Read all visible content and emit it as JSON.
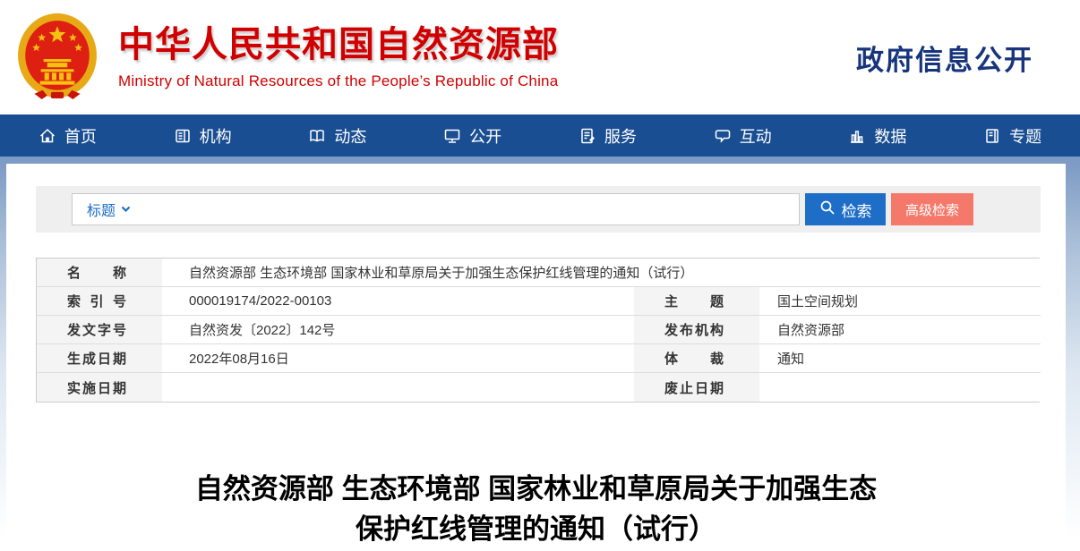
{
  "header": {
    "site_title": "中华人民共和国自然资源部",
    "site_subtitle": "Ministry of Natural Resources of the People’s Republic of China",
    "section_title": "政府信息公开"
  },
  "nav": {
    "items": [
      {
        "label": "首页",
        "icon": "home-icon"
      },
      {
        "label": "机构",
        "icon": "organization-icon"
      },
      {
        "label": "动态",
        "icon": "news-book-icon"
      },
      {
        "label": "公开",
        "icon": "monitor-icon"
      },
      {
        "label": "服务",
        "icon": "document-pencil-icon"
      },
      {
        "label": "互动",
        "icon": "chat-bubble-icon"
      },
      {
        "label": "数据",
        "icon": "bar-chart-icon"
      },
      {
        "label": "专题",
        "icon": "journal-icon"
      }
    ]
  },
  "search": {
    "field_selector": "标题",
    "input_value": "",
    "search_button": "检索",
    "advanced_button": "高级检索"
  },
  "doc_meta": {
    "name_label": "名称",
    "name_value": "自然资源部 生态环境部 国家林业和草原局关于加强生态保护红线管理的通知（试行）",
    "rows": [
      {
        "label1": "索引号",
        "value1": "000019174/2022-00103",
        "label2": "主题",
        "value2": "国土空间规划"
      },
      {
        "label1": "发文字号",
        "value1": "自然资发〔2022〕142号",
        "label2": "发布机构",
        "value2": "自然资源部"
      },
      {
        "label1": "生成日期",
        "value1": "2022年08月16日",
        "label2": "体裁",
        "value2": "通知"
      },
      {
        "label1": "实施日期",
        "value1": "",
        "label2": "废止日期",
        "value2": ""
      }
    ]
  },
  "article": {
    "title": "自然资源部 生态环境部 国家林业和草原局关于加强生态保护红线管理的通知（试行）"
  },
  "colors": {
    "nav_blue": "#1a4e92",
    "strip_blue": "#7d9bc4",
    "brand_red": "#d10000",
    "header_navy": "#17357d",
    "search_button_blue": "#1e6ec8",
    "advanced_button_coral": "#f5796b",
    "label_cell_gray": "#f4f4f4"
  }
}
